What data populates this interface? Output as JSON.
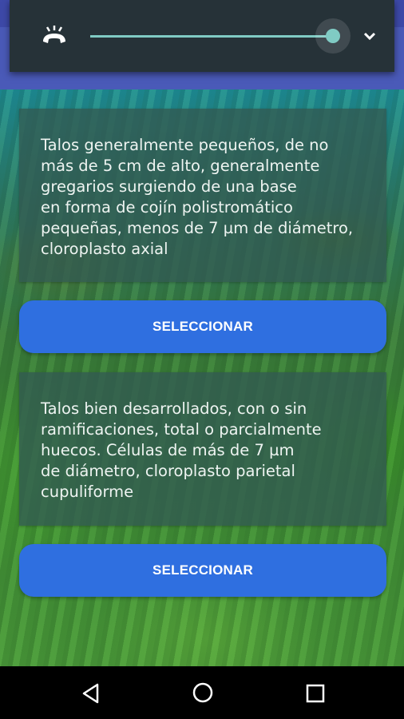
{
  "media": {
    "call_icon": "call-end-icon",
    "volume_level": 1.0,
    "expand_icon": "chevron-down-icon",
    "accent_color": "#80cbc4"
  },
  "options": [
    {
      "description": "Talos generalmente pequeños, de no\nmás de 5 cm de alto, generalmente\ngregarios surgiendo de una base\nen forma de cojín polistromático\npequeñas, menos de 7 µm de diámetro,\ncloroplasto axial",
      "button_label": "SELECCIONAR"
    },
    {
      "description": "Talos bien desarrollados, con o sin\nramificaciones, total o parcialmente\nhuecos. Células de más de 7 µm\nde diámetro, cloroplasto parietal\ncupuliforme",
      "button_label": "SELECCIONAR"
    }
  ],
  "colors": {
    "button": "#2f6fe0",
    "card": "#325a52",
    "status_bar": "#3d49a8",
    "app_bar": "#4a5ab8"
  },
  "navigation": {
    "back_icon": "back-icon",
    "home_icon": "home-icon",
    "recents_icon": "recents-icon"
  }
}
